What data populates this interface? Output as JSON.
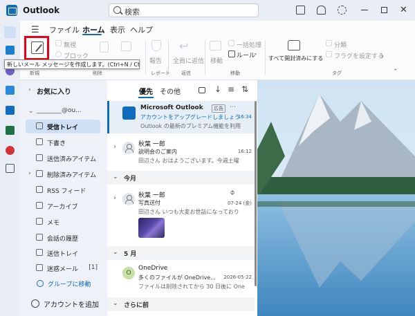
{
  "app": {
    "title": "Outlook"
  },
  "search": {
    "placeholder": "検索"
  },
  "ribbon": {
    "tabs": [
      "ファイル",
      "ホーム",
      "表示",
      "ヘルプ"
    ],
    "buttons": {
      "ignore": "無視",
      "block": "ブロック",
      "report": "報告",
      "reply_all": "全員に返信",
      "move": "移動",
      "sweep": "一括処理",
      "rules": "ルール",
      "mark_all_read": "すべて開封済みにする",
      "categorize": "分類",
      "flag": "フラグを設定する"
    },
    "groups": {
      "new": "新規",
      "delete": "削除",
      "report": "レポート",
      "respond": "返信",
      "move": "移動",
      "tags": "タグ"
    }
  },
  "tooltip": {
    "text": "新しいメール メッセージを作成します。(Ctrl+N / Ctrl+Shift+M)"
  },
  "folders": {
    "favorites": "お気に入り",
    "account": "________@ou...",
    "items": [
      {
        "label": "受信トレイ",
        "count": ""
      },
      {
        "label": "下書き",
        "count": ""
      },
      {
        "label": "送信済みアイテム",
        "count": ""
      },
      {
        "label": "削除済みアイテム",
        "count": ""
      },
      {
        "label": "RSS フィード",
        "count": ""
      },
      {
        "label": "アーカイブ",
        "count": ""
      },
      {
        "label": "メモ",
        "count": ""
      },
      {
        "label": "会話の履歴",
        "count": ""
      },
      {
        "label": "送信トレイ",
        "count": ""
      },
      {
        "label": "迷惑メール",
        "count": "[1]"
      }
    ],
    "go_to_groups": "グループに移動",
    "add_account": "アカウントを追加"
  },
  "message_list": {
    "tab_focused": "優先",
    "tab_other": "その他",
    "sections": [
      "今月",
      "5 月",
      "さらに前"
    ],
    "messages": [
      {
        "sender": "Microsoft Outlook",
        "badge": "広告",
        "subject": "アカウントをアップグレードしましょう",
        "time": "16:34",
        "preview": "Outlook の最新のプレミアム機能を利用"
      },
      {
        "sender": "秋葉 一郎",
        "subject": "説明会のご案内",
        "time": "16:12",
        "preview": "田辺さん おはようございます。今週土曜"
      },
      {
        "sender": "秋葉 一郎",
        "subject": "写真送付",
        "time": "07-24 (金)",
        "preview": "田辺さん いつも大変お世話になっており"
      },
      {
        "sender": "OneDrive",
        "subject": "多くのファイルが OneDrive...",
        "time": "2026-05-22",
        "preview": "ファイルは削除されてから 30 日後に One"
      }
    ]
  },
  "colors": {
    "accent": "#0f6cbd",
    "highlight": "#e8001a",
    "selected": "#cfe0f5"
  }
}
